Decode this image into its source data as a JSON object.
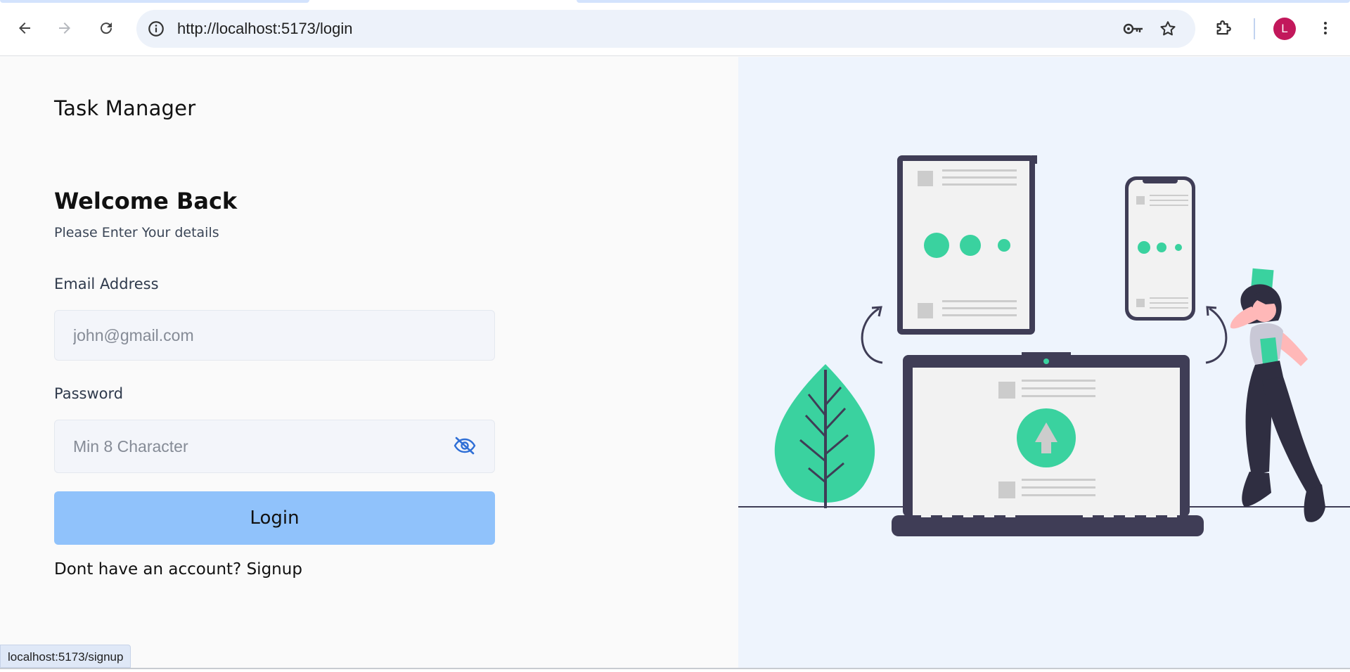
{
  "browser": {
    "url": "http://localhost:5173/login",
    "profile_initial": "L",
    "status_url": "localhost:5173/signup"
  },
  "app": {
    "brand": "Task Manager",
    "heading": "Welcome Back",
    "subheading": "Please Enter Your details",
    "email": {
      "label": "Email Address",
      "placeholder": "john@gmail.com",
      "value": ""
    },
    "password": {
      "label": "Password",
      "placeholder": "Min 8 Character",
      "value": ""
    },
    "login_label": "Login",
    "signup_prompt": "Dont have an account?",
    "signup_link": "Signup"
  },
  "colors": {
    "accent_button": "#90c2fb",
    "illustration_green": "#3ad29f",
    "illustration_dark": "#3f3d56",
    "panel_bg": "#eef4fd"
  }
}
